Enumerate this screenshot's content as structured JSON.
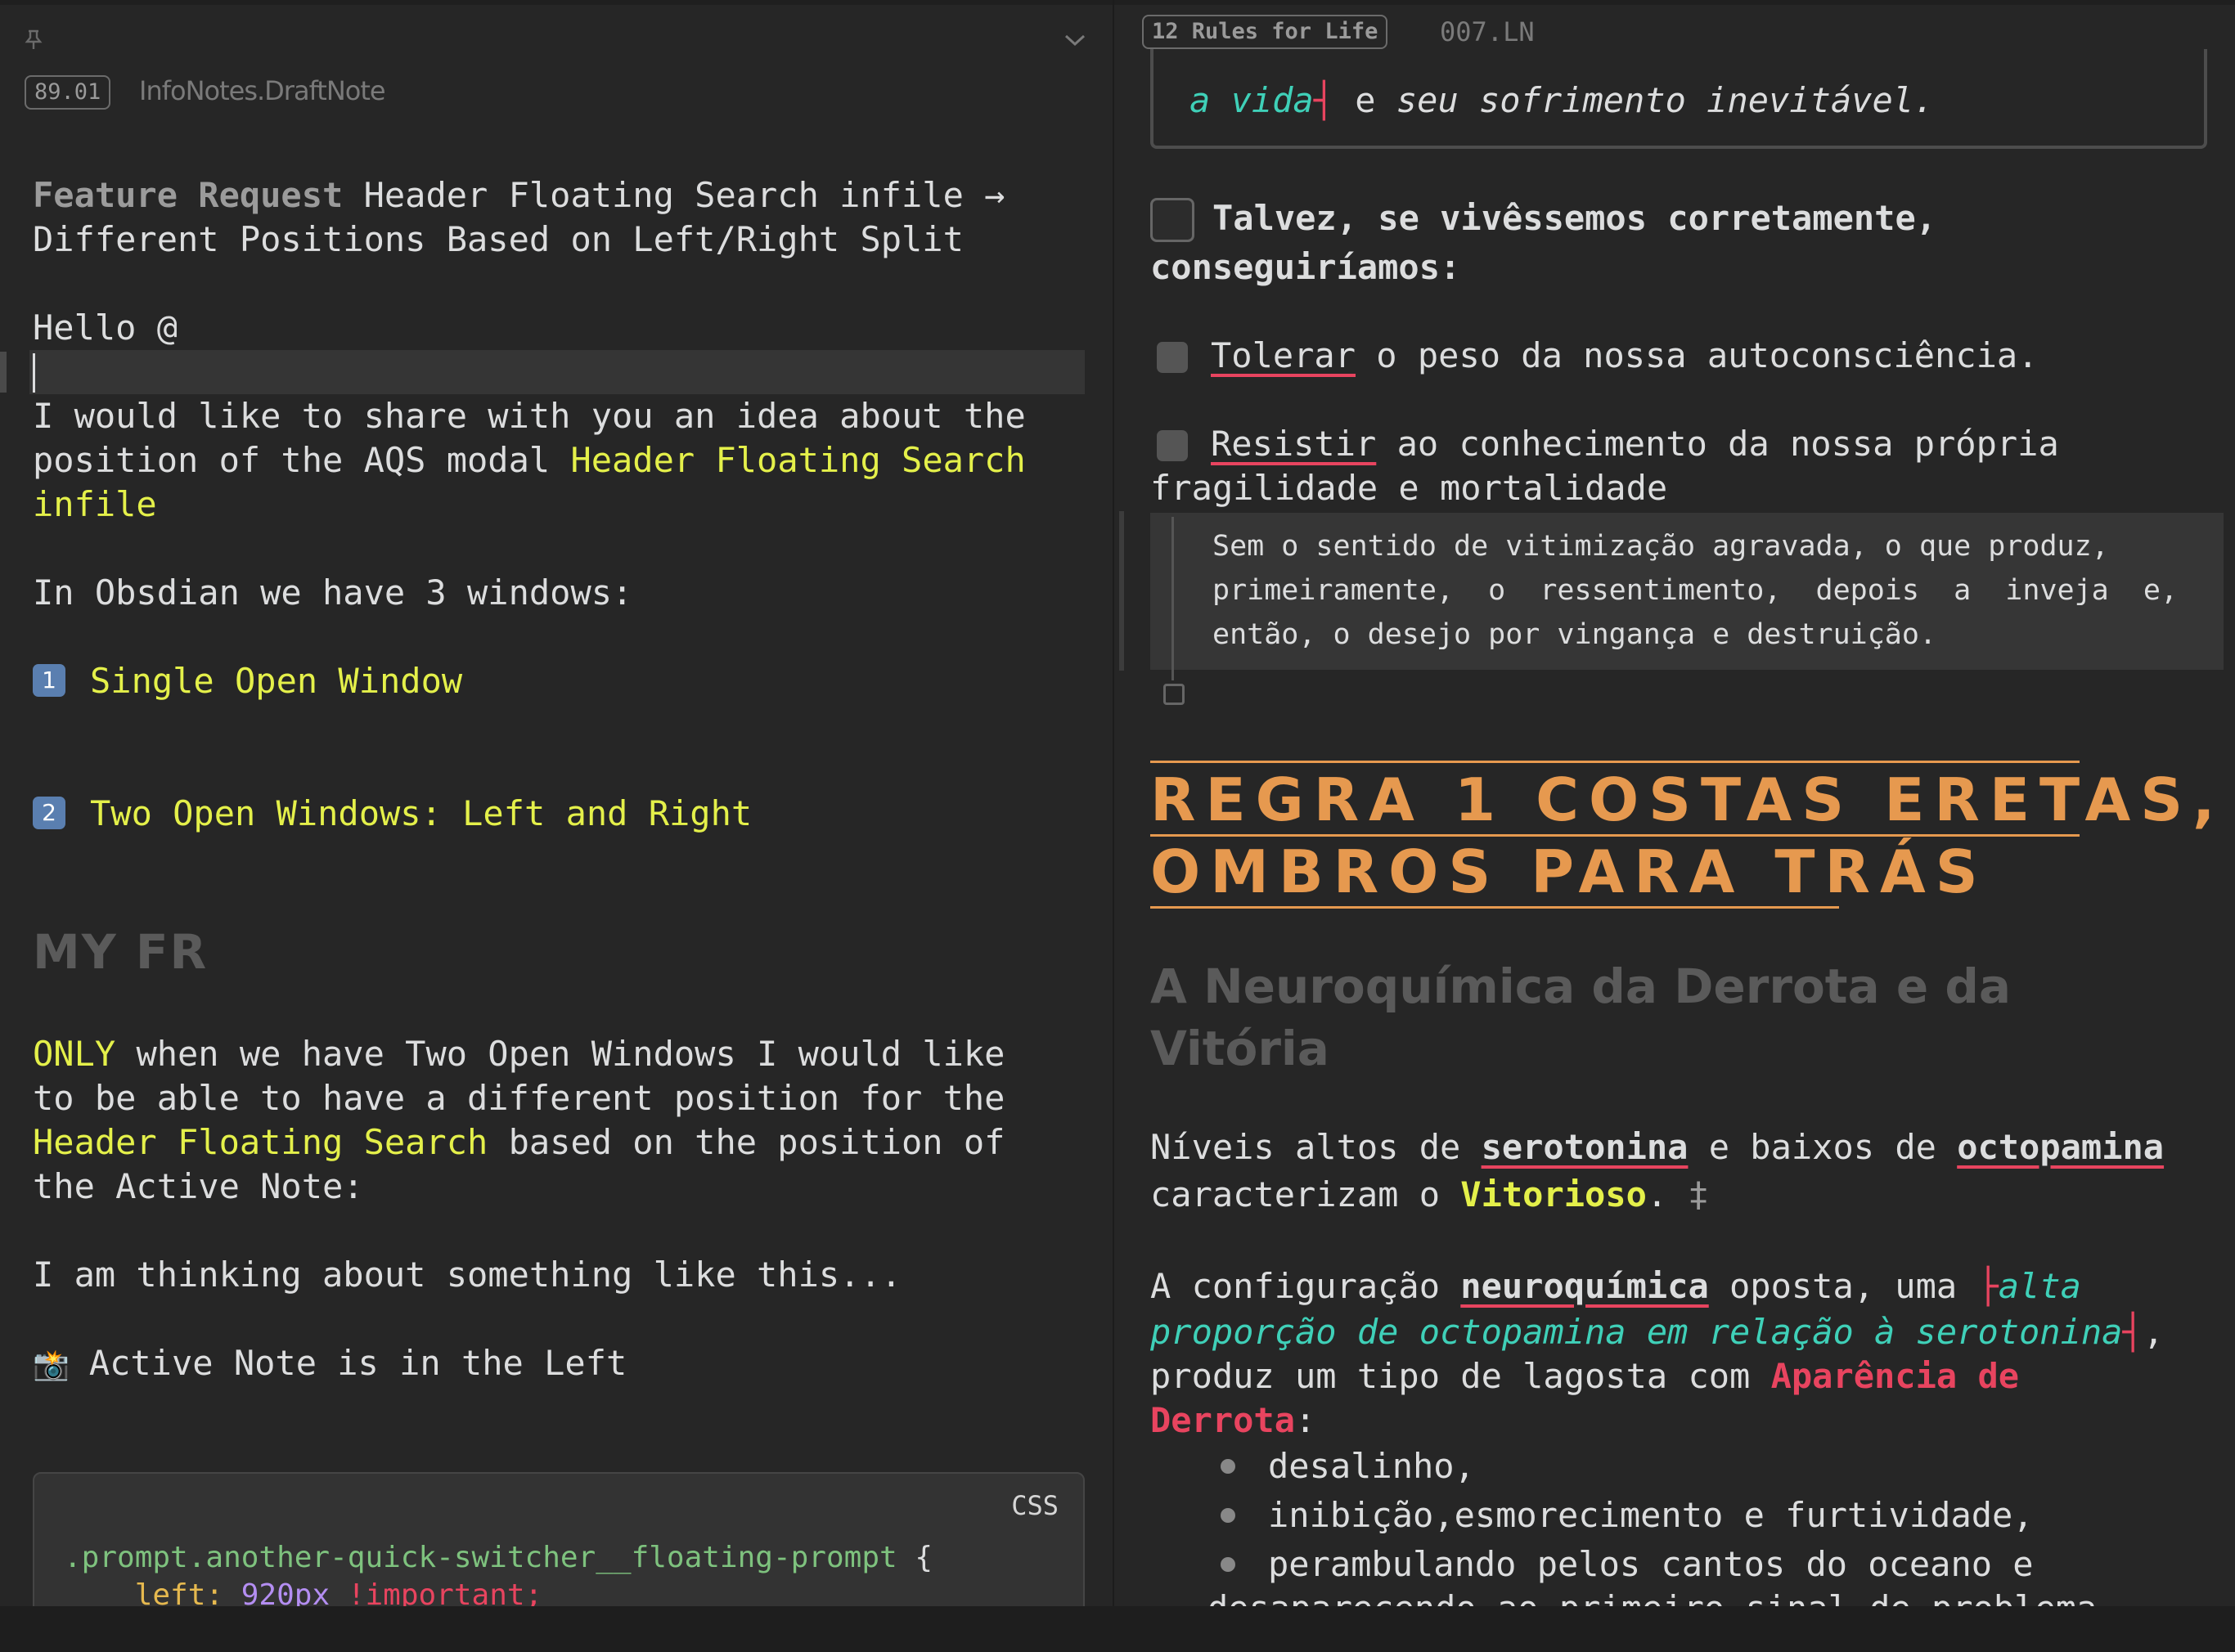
{
  "left": {
    "pin_icon": "pin-icon",
    "collapse_icon": "chevron-down-icon",
    "badge": "89.01",
    "note_title": "InfoNotes.DraftNote",
    "feature_label": "Feature Request",
    "title_rest": " Header Floating Search infile →",
    "title_line2": "Different Positions Based on Left/Right Split",
    "hello": "Hello @",
    "p1_line1": "I would like to share with you an idea about the",
    "p1_line2_a": "position of the AQS modal ",
    "p1_line2_b": "Header Floating Search",
    "p1_line3": "infile",
    "windows_intro": "In Obsdian we have 3 windows:",
    "item1_num": "1",
    "item1": "Single Open Window",
    "item2_num": "2",
    "item2": "Two Open Windows: Left and Right",
    "heading_myfr": "MY FR",
    "p2_only": "ONLY",
    "p2_line1_rest": " when we have Two Open Windows I would like",
    "p2_line2": "to be able to have a different position for the",
    "p2_line3_a": "Header Floating Search",
    "p2_line3_b": " based on the position of",
    "p2_line4": "the Active Note:",
    "thinking": "I am thinking about something like this...",
    "camera_icon": "📸",
    "active_note": "Active Note is in the Left",
    "code_lang": "CSS",
    "code_line1_sel": ".prompt.another-quick-switcher__floating-prompt",
    "code_line1_brace": " {",
    "code_line2_prop": "    left: ",
    "code_line2_val": "920px",
    "code_line2_imp": " !important;"
  },
  "right": {
    "badge": "12 Rules for Life",
    "note_id": "007.LN",
    "quote_a": "a vida",
    "quote_mark": "┤",
    "quote_b": " e ",
    "quote_c": "seu sofrimento inevitável.",
    "task_line1": "Talvez, se vivêssemos corretamente,",
    "task_line2": "conseguiríamos:",
    "sub1_word": "Tolerar",
    "sub1_rest": " o peso da nossa autoconsciência.",
    "sub2_word": "Resistir",
    "sub2_rest": " ao conhecimento da nossa própria",
    "sub2_line2": "fragilidade e mortalidade",
    "callout_l1": "Sem o sentido de vitimização agravada, o que produz,",
    "callout_l2": "primeiramente,  o  ressentimento,  depois  a  inveja  e,",
    "callout_l3": "então, o desejo por vingança e destruição.",
    "h1_line1": "REGRA 1 COSTAS ERETAS,",
    "h1_line2": "OMBROS PARA TRÁS",
    "h2_line1": "A Neuroquímica da Derrota e da",
    "h2_line2": "Vitória",
    "p1_a": "Níveis altos de ",
    "p1_b": "serotonina",
    "p1_c": " e baixos de ",
    "p1_d": "octopamina",
    "p1_line2_a": "caracterizam o ",
    "p1_line2_b": "Vitorioso",
    "p1_line2_c": ".",
    "p1_line2_d": " ‡",
    "p2_a": "A configuração ",
    "p2_b": "neuroquímica",
    "p2_c": " oposta, uma ",
    "p2_mark_open": "├",
    "p2_d": "alta",
    "p2_line2_a": "proporção de octopamina em relação à serotonina",
    "p2_mark_close": "┤",
    "p2_line2_b": ",",
    "p2_line3_a": "produz um tipo de lagosta com ",
    "p2_line3_b": "Aparência de",
    "p2_line4_a": "Derrota",
    "p2_line4_b": ":",
    "bullets": [
      "desalinho,",
      "inibição,esmorecimento e furtividade,",
      "perambulando pelos cantos do oceano e",
      "desaparecendo ao primeiro sinal de problema"
    ]
  }
}
